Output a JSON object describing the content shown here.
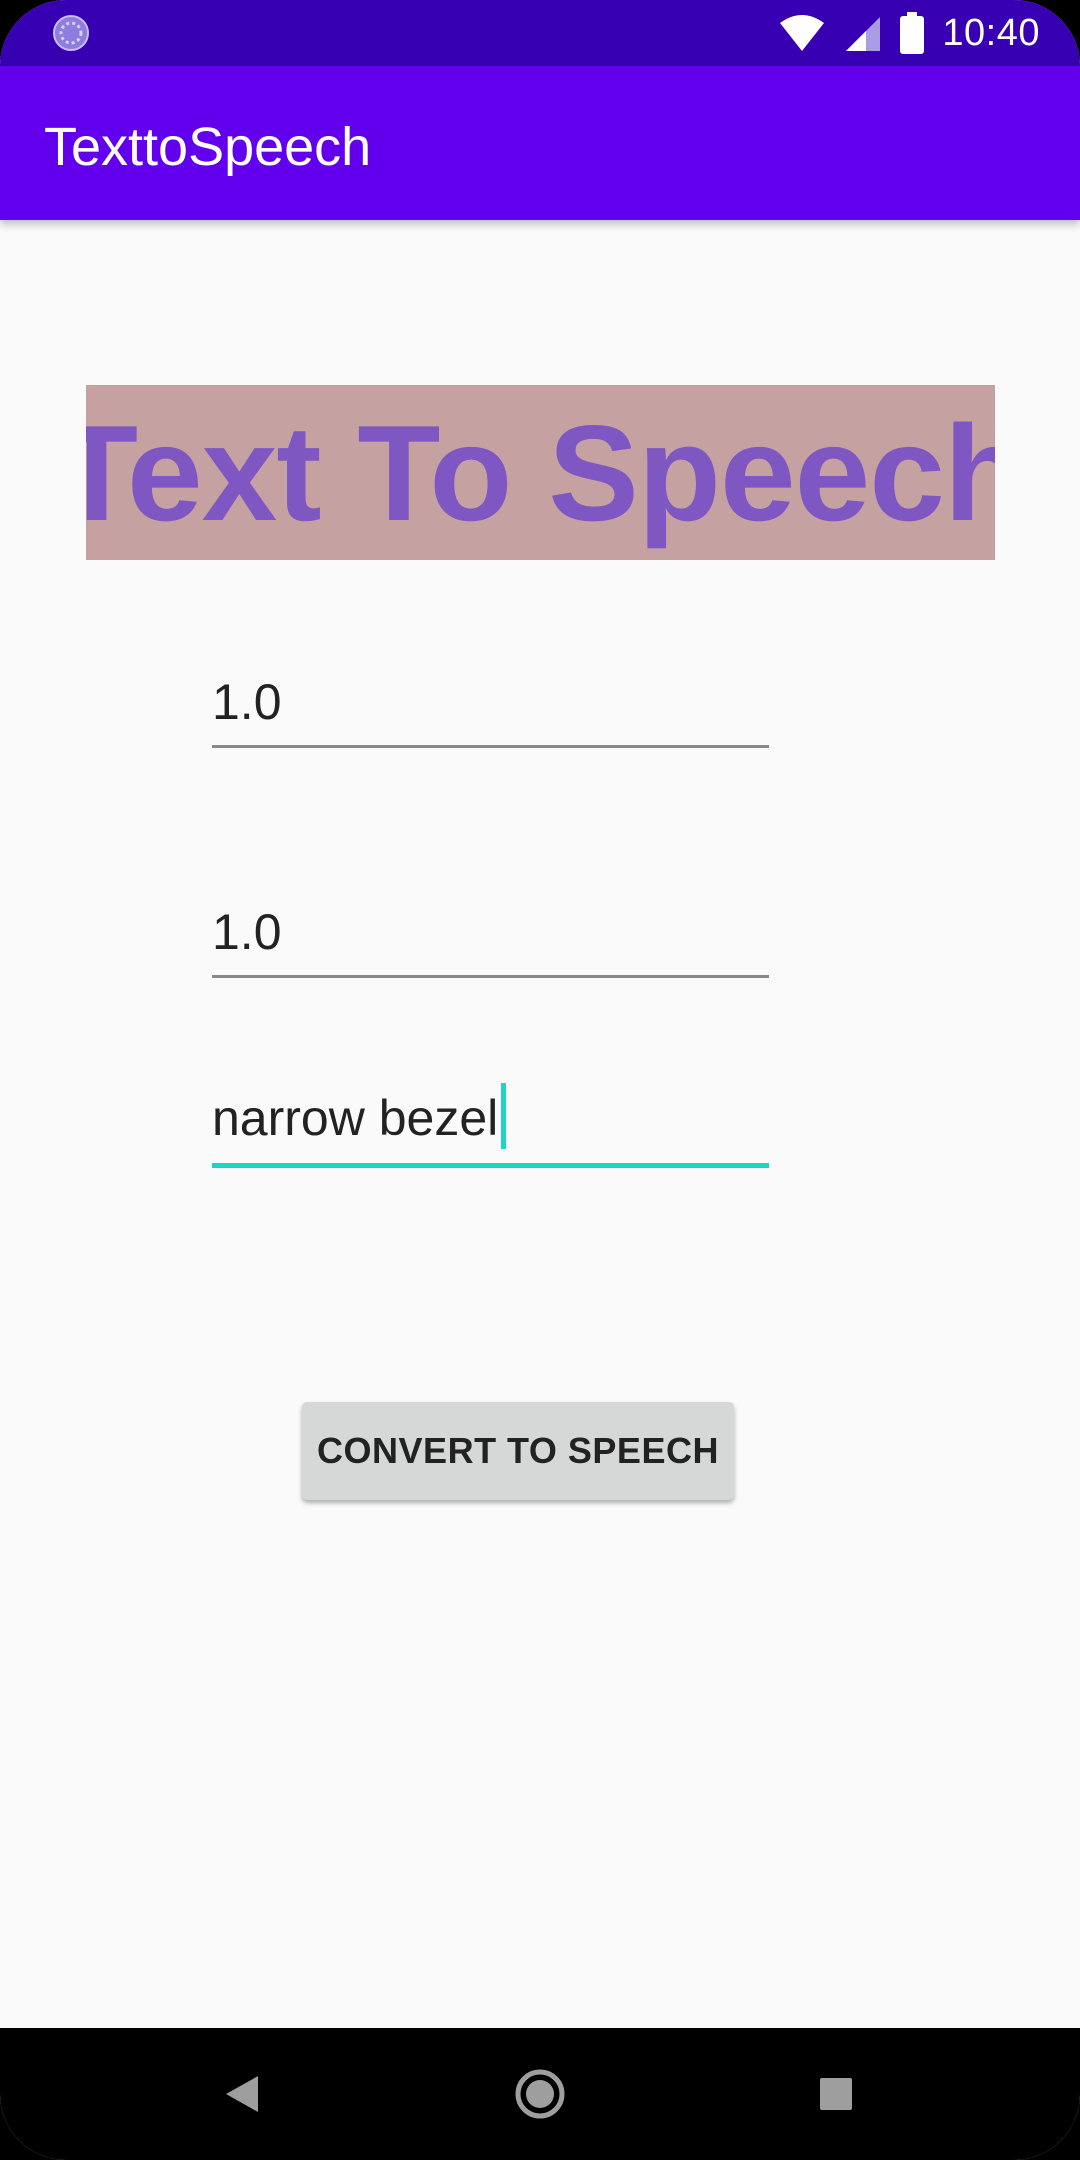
{
  "status_bar": {
    "time": "10:40",
    "left_icon": "circle-progress-icon",
    "icons": [
      "wifi-icon",
      "signal-icon",
      "battery-icon"
    ]
  },
  "app_bar": {
    "title": "TexttoSpeech"
  },
  "main": {
    "heading": "Text To Speech",
    "pitch_value": "1.0",
    "rate_value": "1.0",
    "text_value": "narrow bezel",
    "button_label": "CONVERT TO SPEECH"
  },
  "nav_bar": {
    "buttons": [
      "back-icon",
      "home-icon",
      "recents-icon"
    ]
  },
  "colors": {
    "status_bar": "#3700b3",
    "app_bar": "#6200ee",
    "heading_bg": "#c5a1a1",
    "heading_text": "#7e57c2",
    "focus_accent": "#1fd3c6",
    "button_bg": "#d6d7d7"
  }
}
